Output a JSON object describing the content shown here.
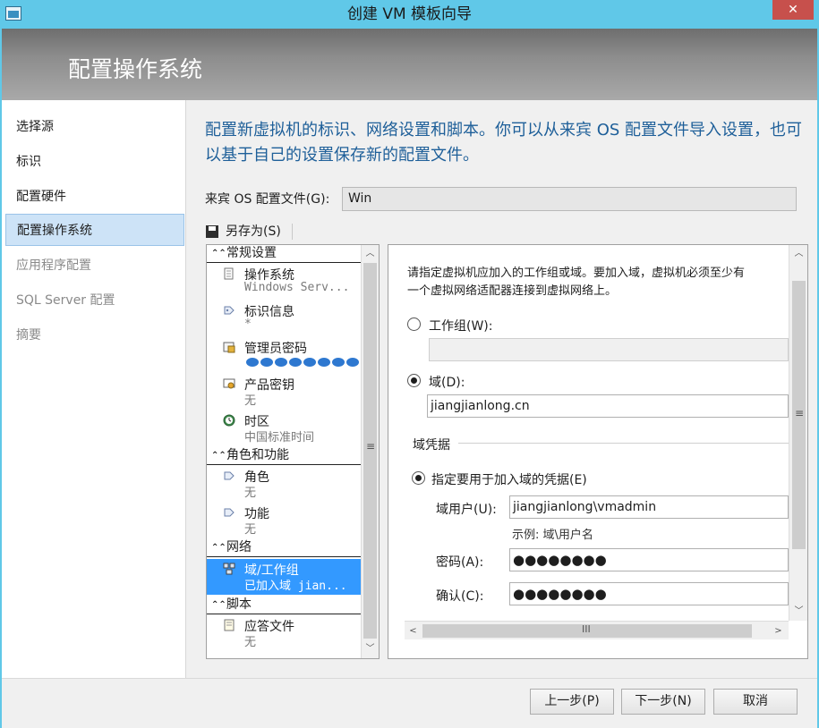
{
  "window": {
    "title": "创建 VM 模板向导",
    "close_glyph": "✕"
  },
  "header": {
    "title": "配置操作系统"
  },
  "nav": {
    "items": [
      {
        "label": "选择源"
      },
      {
        "label": "标识"
      },
      {
        "label": "配置硬件"
      },
      {
        "label": "配置操作系统"
      },
      {
        "label": "应用程序配置"
      },
      {
        "label": "SQL Server 配置"
      },
      {
        "label": "摘要"
      }
    ]
  },
  "main": {
    "intro": "配置新虚拟机的标识、网络设置和脚本。你可以从来宾 OS 配置文件导入设置，也可以基于自己的设置保存新的配置文件。",
    "profile_label": "来宾 OS 配置文件(G):",
    "profile_value": "Win",
    "save_as": "另存为(S)"
  },
  "tree": {
    "groups": {
      "general": "常规设置",
      "roles": "角色和功能",
      "network": "网络",
      "scripts": "脚本"
    },
    "items": {
      "os": {
        "name": "操作系统",
        "sub": "Windows Serv..."
      },
      "identity": {
        "name": "标识信息",
        "sub": "*"
      },
      "admin_pwd": {
        "name": "管理员密码"
      },
      "product_key": {
        "name": "产品密钥",
        "sub": "无"
      },
      "timezone": {
        "name": "时区",
        "sub": "中国标准时间"
      },
      "roles": {
        "name": "角色",
        "sub": "无"
      },
      "features": {
        "name": "功能",
        "sub": "无"
      },
      "domain": {
        "name": "域/工作组",
        "sub": "已加入域 jian..."
      },
      "answer_file": {
        "name": "应答文件",
        "sub": "无"
      }
    }
  },
  "detail": {
    "desc_line1": "请指定虚拟机应加入的工作组或域。要加入域，虚拟机必须至少有",
    "desc_line2": "一个虚拟网络适配器连接到虚拟网络上。",
    "workgroup_label": "工作组(W):",
    "workgroup_value": "",
    "domain_label": "域(D):",
    "domain_value": "jiangjianlong.cn",
    "cred_section": "域凭据",
    "cred_option": "指定要用于加入域的凭据(E)",
    "user_label": "域用户(U):",
    "user_value": "jiangjianlong\\vmadmin",
    "user_hint": "示例: 域\\用户名",
    "password_label": "密码(A):",
    "password_value": "●●●●●●●●",
    "confirm_label": "确认(C):",
    "confirm_value": "●●●●●●●●",
    "selected_option": "domain"
  },
  "footer": {
    "prev": "上一步(P)",
    "next": "下一步(N)",
    "cancel": "取消"
  },
  "icons": {
    "window": "vm-template-icon",
    "save": "floppy-disk-icon",
    "os": "os-icon",
    "identity": "id-tag-icon",
    "admin": "admin-password-icon",
    "key": "product-key-icon",
    "clock": "clock-icon",
    "roles": "role-icon",
    "network": "network-icon",
    "file": "answer-file-icon"
  },
  "colors": {
    "title_bar": "#60c8e8",
    "intro_text": "#1e5f99",
    "selection": "#3399ff",
    "nav_selected": "#cde3f7",
    "password_dots": "#2e78d0"
  }
}
